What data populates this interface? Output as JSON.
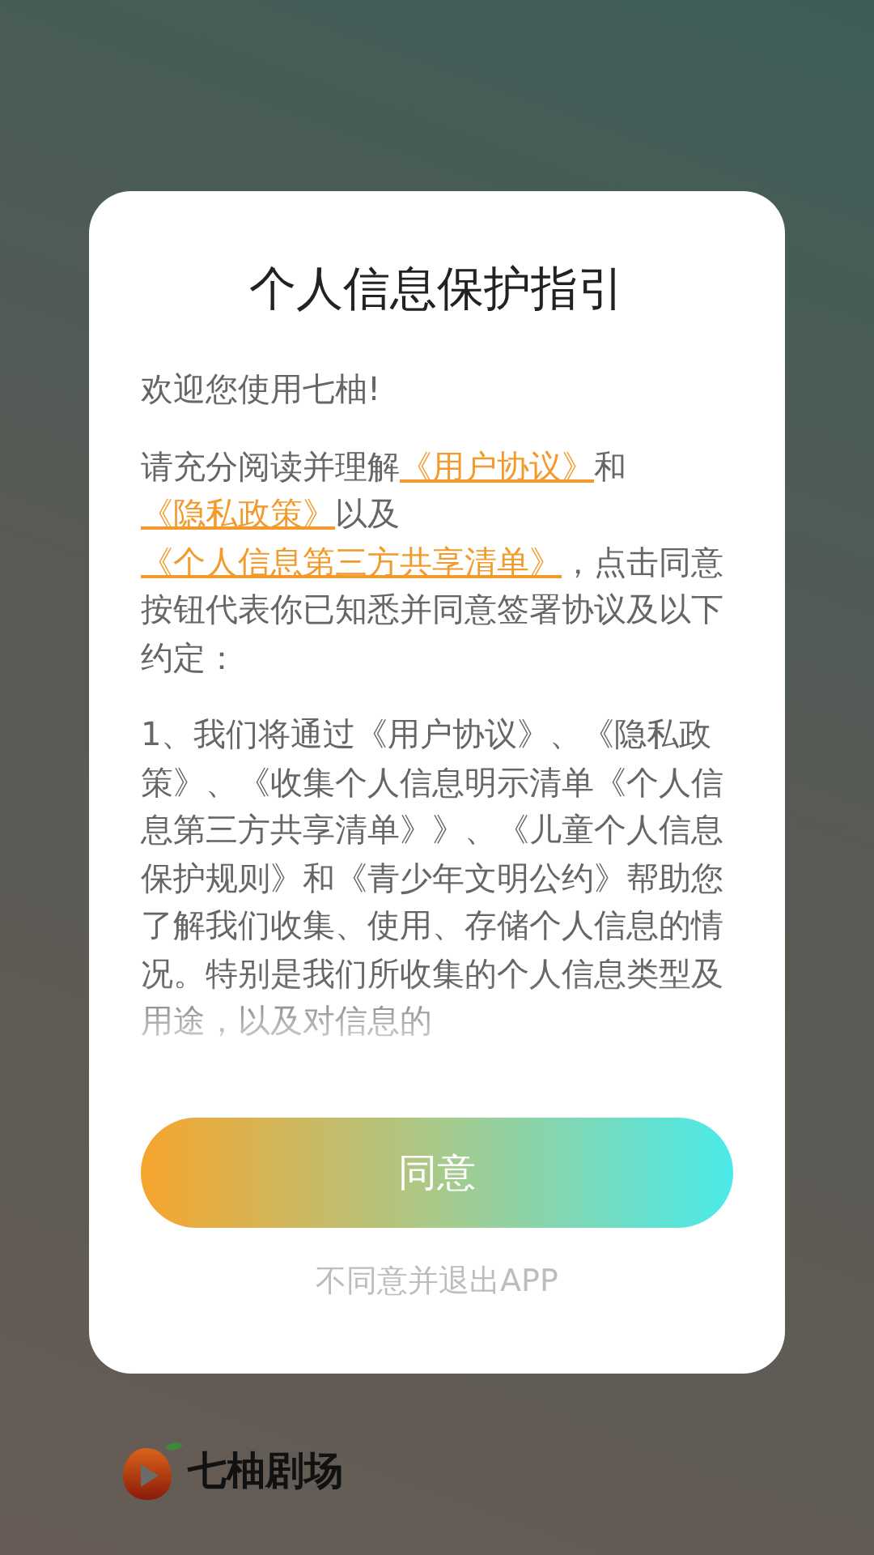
{
  "dialog": {
    "title": "个人信息保护指引",
    "greeting": "欢迎您使用七柚!",
    "consent": [
      {
        "kind": "text",
        "text": "请充分阅读并理解"
      },
      {
        "kind": "link",
        "text": "《用户协议》"
      },
      {
        "kind": "text",
        "text": "和"
      },
      {
        "kind": "link",
        "text": "《隐私政策》"
      },
      {
        "kind": "text",
        "text": "以及"
      },
      {
        "kind": "link",
        "text": "《个人信息第三方共享清单》"
      },
      {
        "kind": "text",
        "text": "，点击同意按钮代表你已知悉并同意签署协议及以下约定："
      }
    ],
    "terms": "1、我们将通过《用户协议》、《隐私政策》、《收集个人信息明示清单《个人信息第三方共享清单》》、《儿童个人信息保护规则》和《青少年文明公约》帮助您了解我们收集、使用、存储个人信息的情况。特别是我们所收集的个人信息类型及用途，以及对信息的",
    "agree_button": "同意",
    "decline_link": "不同意并退出APP"
  },
  "brand": {
    "name": "七柚剧场"
  }
}
